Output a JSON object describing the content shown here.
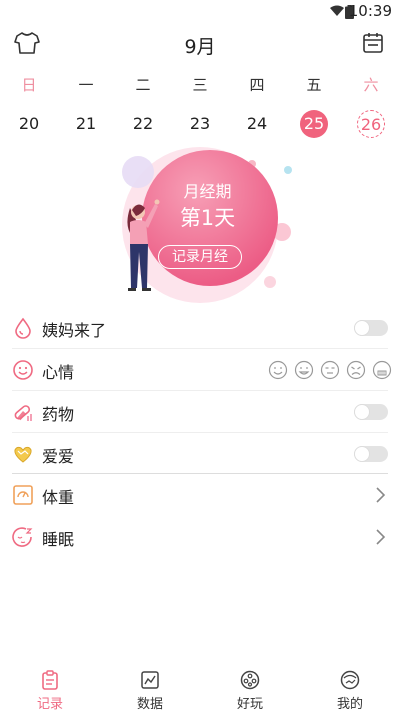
{
  "status_bar": {
    "time": "10:39"
  },
  "header": {
    "month": "9月"
  },
  "week": {
    "days": [
      "日",
      "一",
      "二",
      "三",
      "四",
      "五",
      "六"
    ],
    "dates": [
      "20",
      "21",
      "22",
      "23",
      "24",
      "25",
      "26"
    ]
  },
  "hero": {
    "title": "月经期",
    "day": "第1天",
    "button": "记录月经"
  },
  "list": {
    "period": "姨妈来了",
    "mood": "心情",
    "medicine": "药物",
    "love": "爱爱",
    "weight": "体重",
    "sleep": "睡眠"
  },
  "tabs": [
    {
      "label": "记录"
    },
    {
      "label": "数据"
    },
    {
      "label": "好玩"
    },
    {
      "label": "我的"
    }
  ],
  "colors": {
    "accent": "#f0637d",
    "weekend": "#ef8fa0",
    "toggle_off": "#e3e3e3"
  }
}
